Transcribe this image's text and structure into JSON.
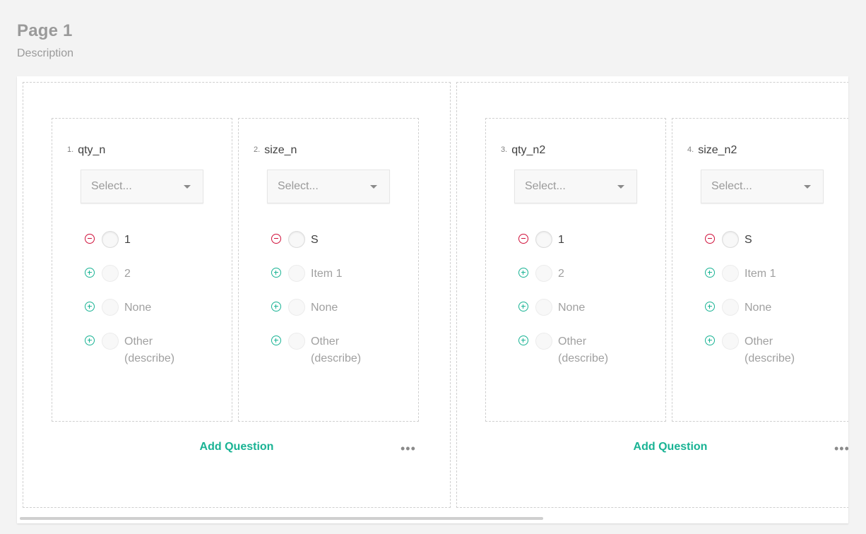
{
  "page": {
    "title": "Page 1",
    "description": "Description"
  },
  "panels": [
    {
      "add_question_label": "Add Question",
      "more_label": "•••",
      "questions": [
        {
          "number": "1.",
          "title": "qty_n",
          "placeholder": "Select...",
          "choices": [
            "1",
            "2",
            "None",
            "Other (describe)"
          ]
        },
        {
          "number": "2.",
          "title": "size_n",
          "placeholder": "Select...",
          "choices": [
            "S",
            "Item 1",
            "None",
            "Other (describe)"
          ]
        }
      ]
    },
    {
      "add_question_label": "Add Question",
      "more_label": "•••",
      "questions": [
        {
          "number": "3.",
          "title": "qty_n2",
          "placeholder": "Select...",
          "choices": [
            "1",
            "2",
            "None",
            "Other (describe)"
          ]
        },
        {
          "number": "4.",
          "title": "size_n2",
          "placeholder": "Select...",
          "choices": [
            "S",
            "Item 1",
            "None",
            "Other (describe)"
          ]
        }
      ]
    }
  ],
  "colors": {
    "accent": "#19b394",
    "remove": "#d0103a",
    "heading": "#9a9a9a"
  },
  "icons": {
    "remove": "minus-circle-icon",
    "add": "plus-circle-icon",
    "dropdown": "caret-down-icon",
    "more": "more-dots-icon"
  }
}
